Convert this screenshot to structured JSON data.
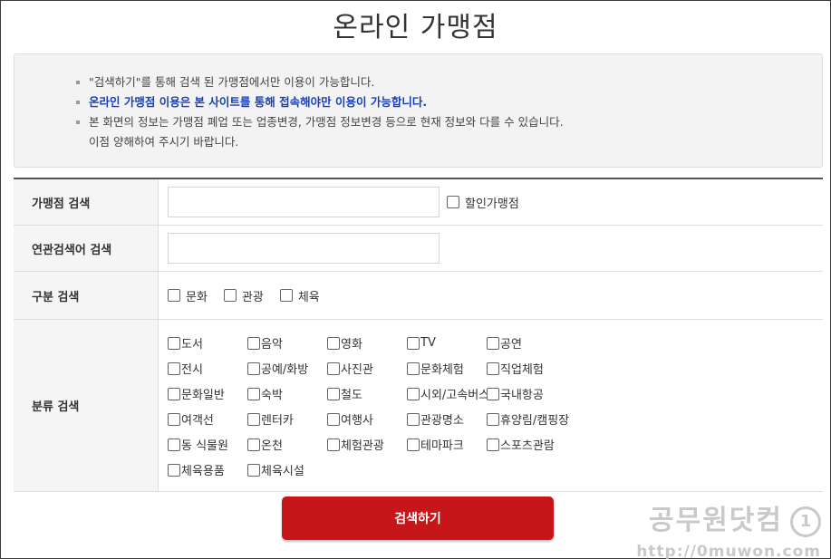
{
  "page_title": "온라인 가맹점",
  "notices": [
    {
      "text": "\"검색하기\"를 통해 검색 된 가맹점에서만 이용이 가능합니다.",
      "emphasis": false
    },
    {
      "text": "온라인 가맹점 이용은 본 사이트를 통해 접속해야만 이용이 가능합니다.",
      "emphasis": true
    },
    {
      "text": "본 화면의 정보는 가맹점 폐업 또는 업종변경, 가맹점 정보변경 등으로 현재 정보와 다를 수 있습니다.",
      "emphasis": false
    },
    {
      "text": "이점 양해하여 주시기 바랍니다.",
      "emphasis": false
    }
  ],
  "form": {
    "store_search": {
      "label": "가맹점 검색",
      "value": "",
      "discount_label": "할인가맹점",
      "discount_checked": false
    },
    "keyword_search": {
      "label": "연관검색어 검색",
      "value": ""
    },
    "type_search": {
      "label": "구분 검색",
      "options": [
        {
          "label": "문화",
          "checked": false
        },
        {
          "label": "관광",
          "checked": false
        },
        {
          "label": "체육",
          "checked": false
        }
      ]
    },
    "category_search": {
      "label": "분류 검색",
      "options": [
        "도서",
        "음악",
        "영화",
        "TV",
        "공연",
        "전시",
        "공예/화방",
        "사진관",
        "문화체험",
        "직업체험",
        "문화일반",
        "숙박",
        "철도",
        "시외/고속버스",
        "국내항공",
        "여객선",
        "렌터카",
        "여행사",
        "관광명소",
        "휴양림/캠핑장",
        "동 식물원",
        "온천",
        "체험관광",
        "테마파크",
        "스포츠관람",
        "체육용품",
        "체육시설"
      ]
    }
  },
  "search_button": "검색하기",
  "watermark": {
    "title": "공무원닷컴",
    "logo": "1",
    "url": "http://0muwon.com"
  },
  "colors": {
    "accent": "#c7161a",
    "emphasis_text": "#1a3fb5"
  }
}
